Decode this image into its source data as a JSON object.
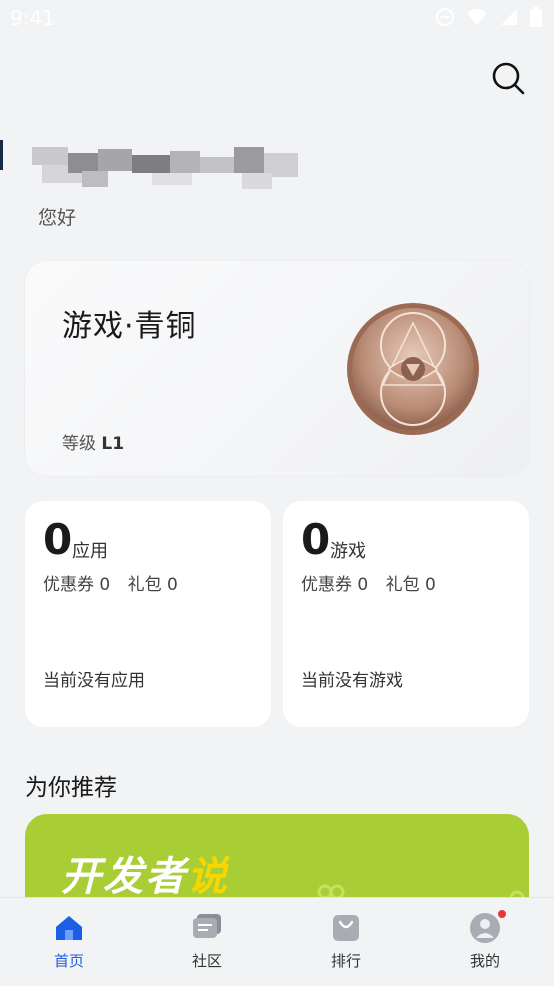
{
  "status_bar": {
    "time": "9:41"
  },
  "header": {
    "search_icon": "search-icon"
  },
  "user": {
    "greeting": "您好"
  },
  "level_card": {
    "title": "游戏·青铜",
    "level_label": "等级",
    "level_value": "L1"
  },
  "stats": [
    {
      "count": "0",
      "label": "应用",
      "coupon": "优惠券 0",
      "gift": "礼包 0",
      "empty": "当前没有应用"
    },
    {
      "count": "0",
      "label": "游戏",
      "coupon": "优惠券 0",
      "gift": "礼包 0",
      "empty": "当前没有游戏"
    }
  ],
  "recommend": {
    "title": "为你推荐",
    "banner_title_main": "开发者",
    "banner_title_highlight": "说"
  },
  "bottom_nav": [
    {
      "label": "首页",
      "icon": "home-icon",
      "active": true
    },
    {
      "label": "社区",
      "icon": "chat-icon",
      "active": false
    },
    {
      "label": "排行",
      "icon": "bag-icon",
      "active": false
    },
    {
      "label": "我的",
      "icon": "profile-icon",
      "active": false
    }
  ],
  "colors": {
    "accent": "#1a5fe6",
    "banner": "#a9cd35",
    "notification": "#e53935"
  }
}
